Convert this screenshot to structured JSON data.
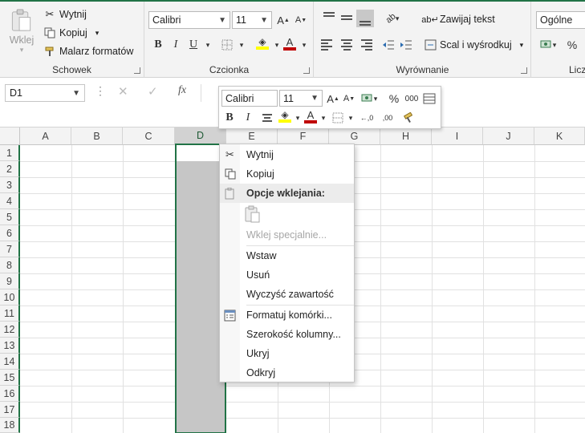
{
  "ribbon": {
    "clipboard": {
      "paste_label": "Wklej",
      "cut_label": "Wytnij",
      "copy_label": "Kopiuj",
      "format_painter_label": "Malarz formatów",
      "group_label": "Schowek"
    },
    "font": {
      "font_name": "Calibri",
      "font_size": "11",
      "group_label": "Czcionka",
      "fill_color": "#ffff00",
      "font_color": "#c00000"
    },
    "alignment": {
      "wrap_text_label": "Zawijaj tekst",
      "merge_center_label": "Scal i wyśrodkuj",
      "group_label": "Wyrównanie"
    },
    "number": {
      "format_value": "Ogólne",
      "percent_symbol": "%",
      "group_label": "Licz"
    }
  },
  "formula_bar": {
    "name_box": "D1",
    "fx_label": "fx",
    "formula": ""
  },
  "mini_toolbar": {
    "font_name": "Calibri",
    "font_size": "11",
    "percent_symbol": "%",
    "thousands_label": "000",
    "bold": "B",
    "italic": "I",
    "increase_decimal": "←,0",
    "decrease_decimal": ",00"
  },
  "grid": {
    "columns": [
      "A",
      "B",
      "C",
      "D",
      "E",
      "F",
      "G",
      "H",
      "I",
      "J",
      "K"
    ],
    "rows": [
      "1",
      "2",
      "3",
      "4",
      "5",
      "6",
      "7",
      "8",
      "9",
      "10",
      "11",
      "12",
      "13",
      "14",
      "15",
      "16",
      "17",
      "18"
    ],
    "selected_column": "D"
  },
  "context_menu": {
    "cut": "Wytnij",
    "copy": "Kopiuj",
    "paste_options_header": "Opcje wklejania:",
    "paste_special": "Wklej specjalnie...",
    "insert": "Wstaw",
    "delete": "Usuń",
    "clear_contents": "Wyczyść zawartość",
    "format_cells": "Formatuj komórki...",
    "column_width": "Szerokość kolumny...",
    "hide": "Ukryj",
    "unhide": "Odkryj"
  },
  "colors": {
    "accent": "#217346",
    "selection_fill": "#c6c6c6",
    "ribbon_bg": "#f3f3f3"
  }
}
